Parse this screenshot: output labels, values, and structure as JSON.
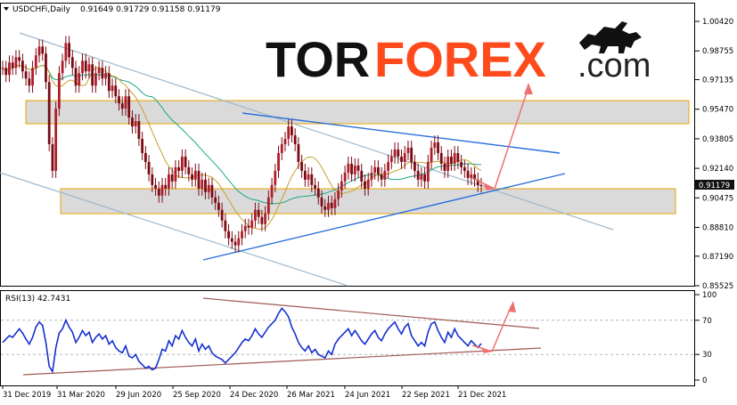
{
  "header": {
    "symbol": "USDCHFi,Daily",
    "ohlc": "0.91649 0.91729 0.91158 0.91179"
  },
  "logo": {
    "part1": "TOR",
    "part2": "FOREX",
    "part3": ".com"
  },
  "chart_data": [
    {
      "type": "line",
      "title": "USDCHFi,Daily",
      "subtitle": "0.91649 0.91729 0.91158 0.91179",
      "y_ticks": [
        "1.00420",
        "0.98755",
        "0.97135",
        "0.95470",
        "0.93805",
        "0.92140",
        "0.90475",
        "0.88810",
        "0.87190",
        "0.85525"
      ],
      "ylim": [
        0.85525,
        1.0042
      ],
      "current_price": "0.91179",
      "x_tick_labels": [
        "31 Dec 2019",
        "31 Mar 2020",
        "29 Jun 2020",
        "25 Sep 2020",
        "24 Dec 2020",
        "26 Mar 2021",
        "24 Jun 2021",
        "22 Sep 2021",
        "21 Dec 2021"
      ],
      "series": [
        {
          "values": [
            0.978,
            0.974,
            0.981,
            0.978,
            0.984,
            0.982,
            0.976,
            0.972,
            0.968,
            0.978,
            0.985,
            0.99,
            0.986,
            0.97,
            0.935,
            0.92,
            0.955,
            0.975,
            0.982,
            0.992,
            0.984,
            0.978,
            0.968,
            0.975,
            0.982,
            0.976,
            0.98,
            0.968,
            0.975,
            0.978,
            0.972,
            0.975,
            0.965,
            0.968,
            0.962,
            0.958,
            0.955,
            0.962,
            0.95,
            0.945,
            0.948,
            0.938,
            0.93,
            0.925,
            0.918,
            0.912,
            0.91,
            0.906,
            0.912,
            0.91,
            0.918,
            0.914,
            0.922,
            0.92,
            0.928,
            0.922,
            0.918,
            0.915,
            0.92,
            0.91,
            0.915,
            0.908,
            0.912,
            0.905,
            0.902,
            0.898,
            0.892,
            0.886,
            0.882,
            0.88,
            0.878,
            0.882,
            0.886,
            0.889,
            0.888,
            0.892,
            0.898,
            0.894,
            0.89,
            0.896,
            0.905,
            0.912,
            0.92,
            0.93,
            0.935,
            0.938,
            0.945,
            0.94,
            0.935,
            0.925,
            0.92,
            0.915,
            0.918,
            0.912,
            0.91,
            0.905,
            0.9,
            0.898,
            0.902,
            0.899,
            0.904,
            0.909,
            0.914,
            0.919,
            0.924,
            0.918,
            0.923,
            0.92,
            0.914,
            0.91,
            0.915,
            0.919,
            0.922,
            0.918,
            0.915,
            0.92,
            0.925,
            0.928,
            0.932,
            0.928,
            0.925,
            0.93,
            0.933,
            0.925,
            0.92,
            0.915,
            0.918,
            0.914,
            0.925,
            0.933,
            0.936,
            0.93,
            0.924,
            0.92,
            0.928,
            0.924,
            0.93,
            0.925,
            0.922,
            0.92,
            0.916,
            0.918,
            0.915,
            0.912,
            0.9118
          ]
        }
      ]
    },
    {
      "type": "line",
      "title": "RSI(13) 42.7431",
      "y_ticks": [
        "100",
        "70",
        "30",
        "0"
      ],
      "ylim": [
        0,
        100
      ],
      "x_tick_labels": [
        "31 Dec 2019",
        "31 Mar 2020",
        "29 Jun 2020",
        "25 Sep 2020",
        "24 Dec 2020",
        "26 Mar 2021",
        "24 Jun 2021",
        "22 Sep 2021",
        "21 Dec 2021"
      ],
      "series": [
        {
          "name": "RSI(13)",
          "values": [
            44,
            48,
            52,
            50,
            55,
            60,
            55,
            48,
            42,
            50,
            62,
            68,
            64,
            44,
            16,
            10,
            38,
            55,
            60,
            70,
            62,
            56,
            44,
            50,
            58,
            52,
            56,
            44,
            50,
            54,
            48,
            52,
            42,
            46,
            38,
            34,
            32,
            40,
            28,
            26,
            30,
            22,
            18,
            14,
            16,
            12,
            14,
            24,
            36,
            34,
            46,
            40,
            52,
            48,
            58,
            50,
            44,
            40,
            48,
            34,
            42,
            36,
            40,
            32,
            28,
            26,
            24,
            20,
            24,
            28,
            32,
            38,
            44,
            48,
            46,
            52,
            60,
            54,
            50,
            56,
            62,
            66,
            70,
            78,
            84,
            80,
            74,
            62,
            54,
            44,
            38,
            34,
            40,
            32,
            36,
            30,
            28,
            26,
            34,
            30,
            42,
            48,
            52,
            56,
            60,
            52,
            58,
            52,
            46,
            42,
            48,
            54,
            58,
            50,
            46,
            54,
            60,
            64,
            68,
            60,
            54,
            62,
            66,
            52,
            46,
            40,
            44,
            40,
            56,
            66,
            68,
            58,
            50,
            44,
            56,
            50,
            60,
            52,
            48,
            44,
            40,
            46,
            42,
            38,
            42.7431
          ]
        }
      ]
    }
  ]
}
